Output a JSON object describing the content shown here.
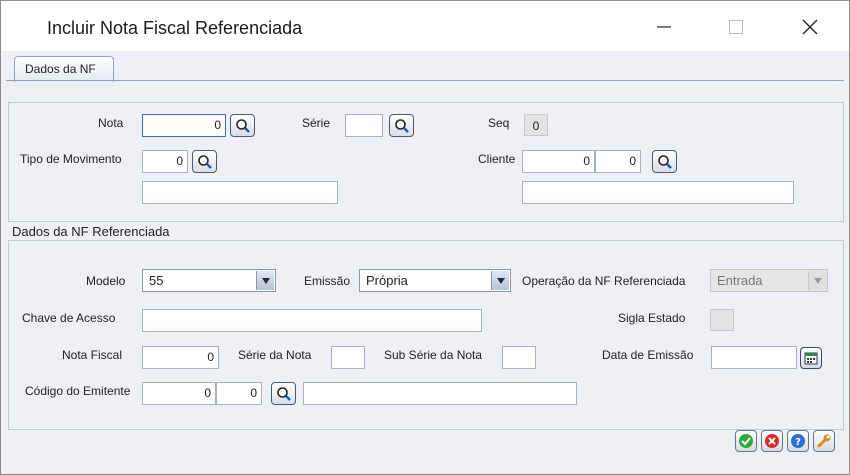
{
  "window": {
    "title": "Incluir Nota Fiscal Referenciada"
  },
  "tabs": [
    {
      "label": "Dados da NF"
    }
  ],
  "dados_nf": {
    "nota": {
      "label": "Nota",
      "value": "0"
    },
    "serie": {
      "label": "Série",
      "value": ""
    },
    "seq": {
      "label": "Seq",
      "value": "0"
    },
    "tipo_movimento": {
      "label": "Tipo de Movimento",
      "value": "0",
      "description": ""
    },
    "cliente": {
      "label": "Cliente",
      "value1": "0",
      "value2": "0",
      "description": ""
    }
  },
  "referenciada": {
    "section_title": "Dados da NF Referenciada",
    "modelo": {
      "label": "Modelo",
      "value": "55"
    },
    "emissao": {
      "label": "Emissão",
      "value": "Própria"
    },
    "operacao": {
      "label": "Operação da NF Referenciada",
      "value": "Entrada"
    },
    "chave_acesso": {
      "label": "Chave de Acesso",
      "value": ""
    },
    "sigla_estado": {
      "label": "Sigla Estado",
      "value": ""
    },
    "nota_fiscal": {
      "label": "Nota Fiscal",
      "value": "0"
    },
    "serie_nota": {
      "label": "Série da Nota",
      "value": ""
    },
    "sub_serie": {
      "label": "Sub Série da Nota",
      "value": ""
    },
    "data_emissao": {
      "label": "Data de Emissão",
      "value": ""
    },
    "codigo_emitente": {
      "label": "Código do Emitente",
      "value1": "0",
      "value2": "0",
      "description": ""
    }
  },
  "footer_buttons": [
    {
      "icon": "ok-icon",
      "color": "#2eaa3c"
    },
    {
      "icon": "cancel-icon",
      "color": "#d92b2b"
    },
    {
      "icon": "help-icon",
      "color": "#2a6fd6"
    },
    {
      "icon": "wrench-icon",
      "color": "#e08a1e"
    }
  ]
}
